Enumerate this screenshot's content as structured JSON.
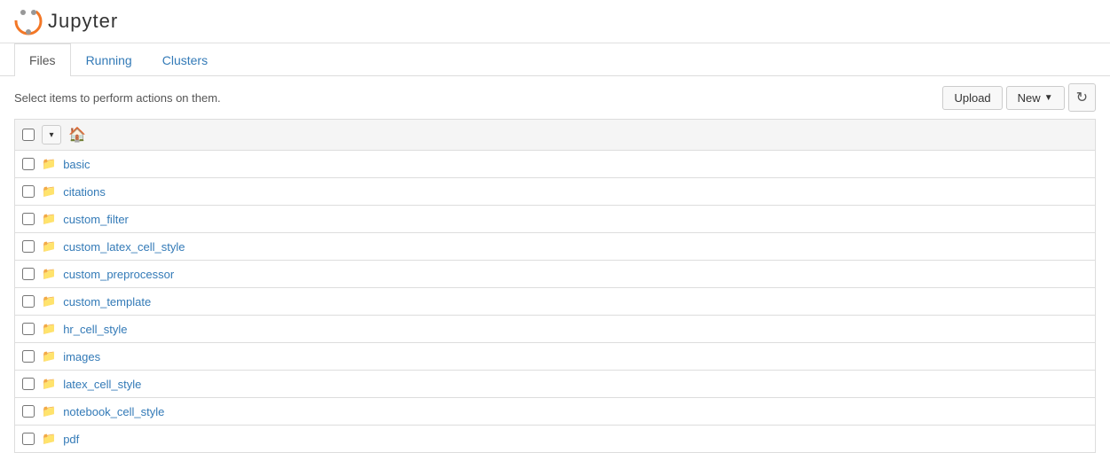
{
  "header": {
    "logo_text": "Jupyter",
    "logo_icon_alt": "jupyter-logo"
  },
  "tabs": [
    {
      "label": "Files",
      "active": true
    },
    {
      "label": "Running",
      "active": false
    },
    {
      "label": "Clusters",
      "active": false
    }
  ],
  "toolbar": {
    "instruction": "Select items to perform actions on them.",
    "upload_label": "Upload",
    "new_label": "New",
    "new_dropdown_arrow": "▼",
    "refresh_icon": "↻"
  },
  "file_list": {
    "items": [
      {
        "name": "basic",
        "type": "folder"
      },
      {
        "name": "citations",
        "type": "folder"
      },
      {
        "name": "custom_filter",
        "type": "folder"
      },
      {
        "name": "custom_latex_cell_style",
        "type": "folder"
      },
      {
        "name": "custom_preprocessor",
        "type": "folder"
      },
      {
        "name": "custom_template",
        "type": "folder"
      },
      {
        "name": "hr_cell_style",
        "type": "folder"
      },
      {
        "name": "images",
        "type": "folder"
      },
      {
        "name": "latex_cell_style",
        "type": "folder"
      },
      {
        "name": "notebook_cell_style",
        "type": "folder"
      },
      {
        "name": "pdf",
        "type": "folder"
      }
    ]
  }
}
